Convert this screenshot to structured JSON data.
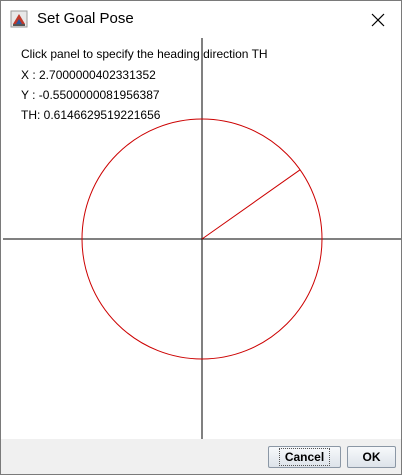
{
  "window": {
    "title": "Set Goal Pose"
  },
  "panel": {
    "instruction": "Click panel to specify the heading direction TH",
    "x_line": "X : 2.7000000402331352",
    "y_line": "Y : -0.5500000081956387",
    "th_line": "TH: 0.6146629519221656",
    "heading_rad": 0.6146629519221656
  },
  "buttons": {
    "cancel": "Cancel",
    "ok": "OK"
  },
  "colors": {
    "axes": "#000000",
    "circle": "#cc0000",
    "heading": "#cc0000"
  },
  "icons": {
    "app": "java-app-icon",
    "close": "close-icon"
  }
}
